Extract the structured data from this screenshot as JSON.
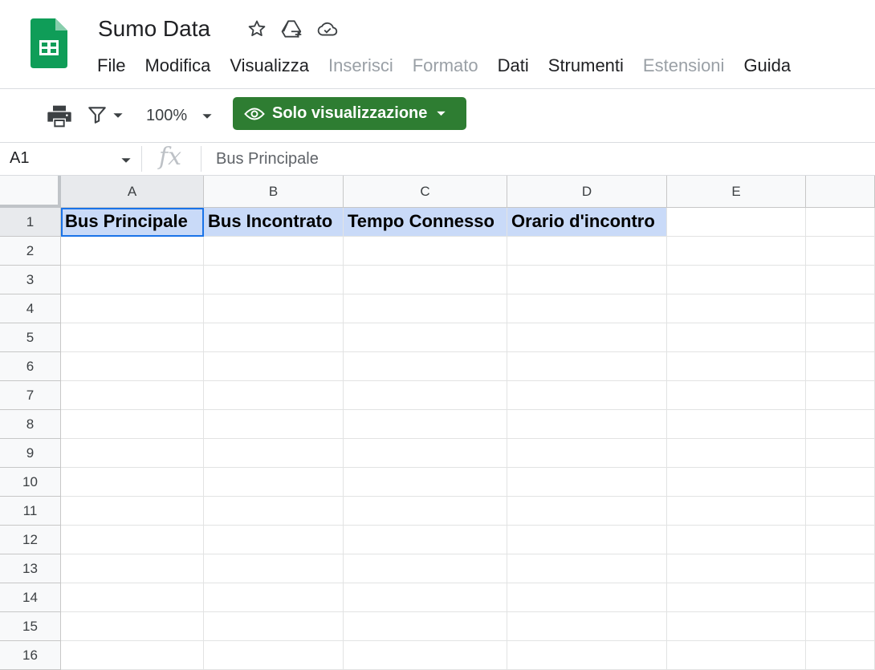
{
  "document": {
    "title": "Sumo Data"
  },
  "title_icons": [
    "star-icon",
    "move-to-drive-icon",
    "cloud-status-icon"
  ],
  "menu": [
    {
      "label": "File",
      "enabled": true
    },
    {
      "label": "Modifica",
      "enabled": true
    },
    {
      "label": "Visualizza",
      "enabled": true
    },
    {
      "label": "Inserisci",
      "enabled": false
    },
    {
      "label": "Formato",
      "enabled": false
    },
    {
      "label": "Dati",
      "enabled": true
    },
    {
      "label": "Strumenti",
      "enabled": true
    },
    {
      "label": "Estensioni",
      "enabled": false
    },
    {
      "label": "Guida",
      "enabled": true
    }
  ],
  "toolbar": {
    "zoom": "100%",
    "view_only_label": "Solo visualizzazione"
  },
  "formula_bar": {
    "cell_ref": "A1",
    "fx": "fx",
    "content": "Bus Principale"
  },
  "grid": {
    "columns": [
      "A",
      "B",
      "C",
      "D",
      "E"
    ],
    "rows": [
      "1",
      "2",
      "3",
      "4",
      "5",
      "6",
      "7",
      "8",
      "9",
      "10",
      "11",
      "12",
      "13",
      "14",
      "15",
      "16"
    ],
    "header_row": [
      "Bus Principale",
      "Bus Incontrato",
      "Tempo Connesso",
      "Orario d'incontro",
      ""
    ],
    "active_cell": "A1"
  },
  "colors": {
    "brand_green": "#0f9d58",
    "view_only_green": "#2e7d32",
    "header_fill": "#c9daf8",
    "selection_blue": "#1a73e8"
  }
}
